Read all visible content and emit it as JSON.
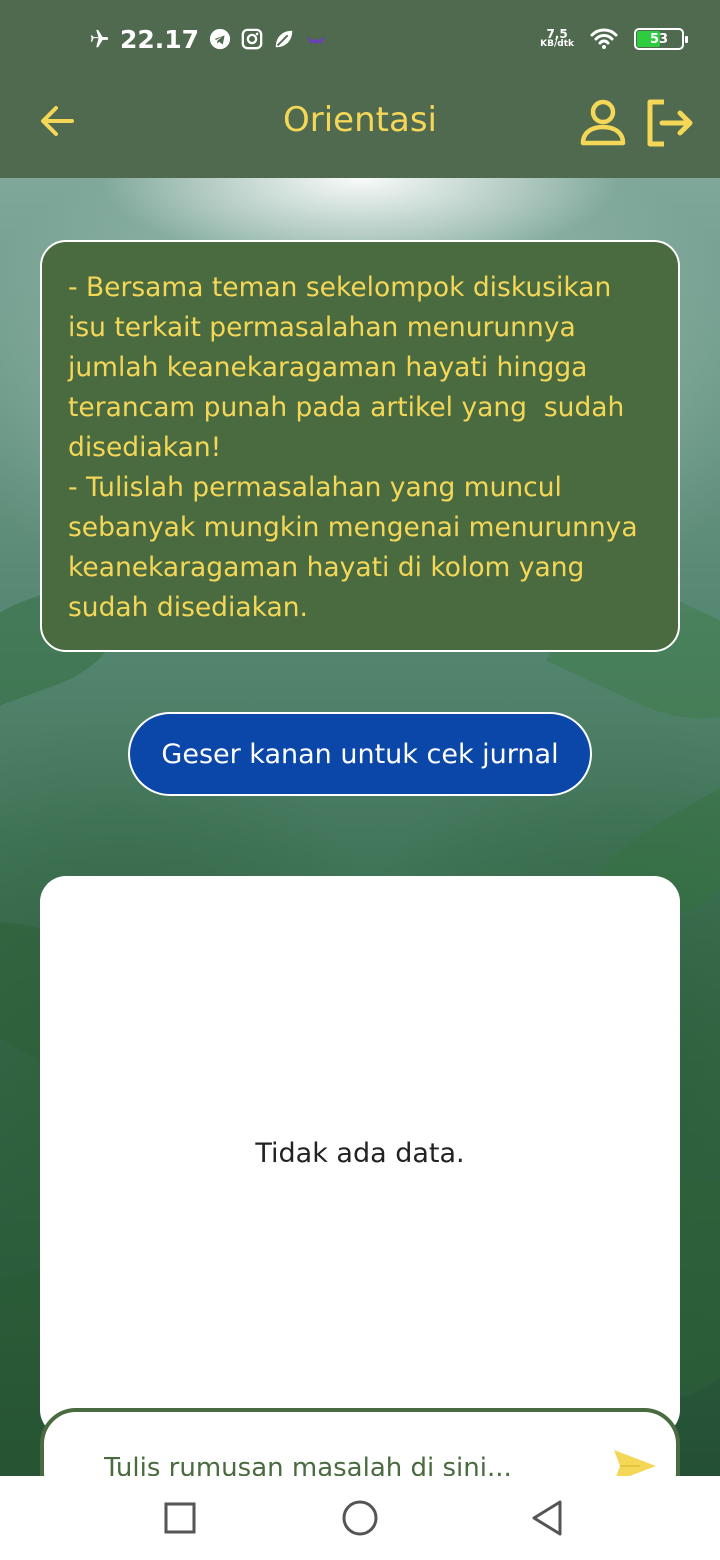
{
  "status_bar": {
    "time": "22.17",
    "net_speed_value": "7,5",
    "net_speed_unit": "KB/dtk",
    "battery_level": "53",
    "icons": [
      "airplane-icon",
      "telegram-icon",
      "instagram-icon",
      "leaf-app-icon",
      "bat-icon",
      "wifi-icon",
      "battery-icon"
    ]
  },
  "app_bar": {
    "title": "Orientasi",
    "icons": [
      "back-arrow-icon",
      "profile-icon",
      "logout-icon"
    ]
  },
  "instruction": {
    "text": "- Bersama teman sekelompok diskusikan isu terkait permasalahan menurunnya jumlah keanekaragaman hayati hingga terancam punah pada artikel yang  sudah disediakan!\n- Tulislah permasalahan yang muncul sebanyak mungkin mengenai menurunnya keanekaragaman hayati di kolom yang sudah disediakan."
  },
  "journal_button": {
    "label": "Geser kanan untuk cek jurnal"
  },
  "data_card": {
    "empty_text": "Tidak ada data."
  },
  "input": {
    "placeholder": "Tulis rumusan masalah di sini...",
    "value": ""
  },
  "colors": {
    "header": "#4f6a4e",
    "accent_yellow": "#f5d758",
    "panel_green": "#4a6b3f",
    "button_blue": "#0b47a8"
  }
}
